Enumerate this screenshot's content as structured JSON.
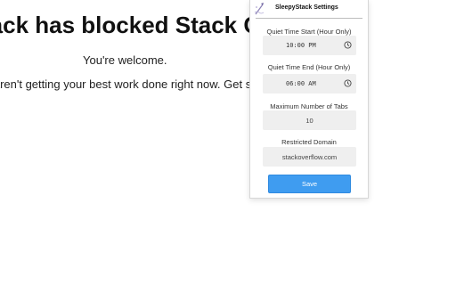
{
  "page": {
    "heading": "tack has blocked Stack O",
    "line1": "You're welcome.",
    "line2": "u aren't getting your best work done right now. Get so"
  },
  "popup": {
    "title": "SleepyStack Settings",
    "fields": {
      "quiet_start": {
        "label": "Quiet Time Start (Hour Only)",
        "value": "10:00 PM"
      },
      "quiet_end": {
        "label": "Quiet Time End (Hour Only)",
        "value": "06:00 AM"
      },
      "max_tabs": {
        "label": "Maximum Number of Tabs",
        "value": "10"
      },
      "domain": {
        "label": "Restricted Domain",
        "value": "stackoverflow.com"
      }
    },
    "save_label": "Save",
    "colors": {
      "accent": "#3f9cf0",
      "field_bg": "#efefef"
    },
    "icons": {
      "logo": "sleepy-stack-logo",
      "time": "clock-icon"
    }
  }
}
